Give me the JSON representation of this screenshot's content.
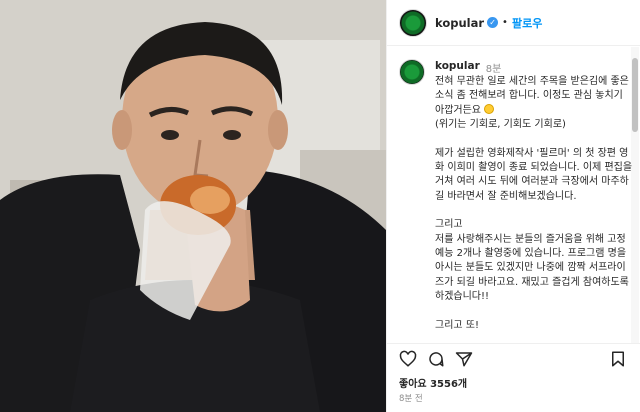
{
  "post": {
    "username": "kopular",
    "follow_label": "팔로우",
    "separator": "•",
    "caption_username": "kopular",
    "caption_time": "8분",
    "caption_paragraphs": [
      "전혀 무관한 일로 세간의 주목을 받은김에 좋은 소식 좀 전해보려 합니다. 이정도 관심 놓치기 아깝거든요",
      "(위기는 기회로, 기회도 기회로)",
      "제가 설립한 영화제작사 '필르머' 의 첫 장편 영화 이희미 촬영이 종료 되었습니다. 이제 편집을 거쳐 여러 시도 뒤에 여러분과 극장에서 마주하길 바라면서 잘 준비해보겠습니다.",
      "그리고\n저를 사랑해주시는 분들의 즐거움을 위해 고정 예능 2개나 촬영중에 있습니다. 프로그램 명을 아시는 분들도 있겠지만 나중에 깜짝 서프라이즈가 되길 바라고요. 재밌고 즐겁게 참여하도록 하겠습니다!!",
      "그리고 또!"
    ],
    "likes_text": "좋아요 3556개",
    "posted_time": "8분 전"
  },
  "icons": {
    "like": "heart-icon",
    "comment": "comment-icon",
    "share": "share-icon",
    "save": "bookmark-icon",
    "verified": "verified-badge-icon",
    "emoji": "grinning-face-emoji"
  },
  "colors": {
    "follow": "#0095f6",
    "verified": "#3897f0",
    "muted": "#8e8e8e"
  }
}
